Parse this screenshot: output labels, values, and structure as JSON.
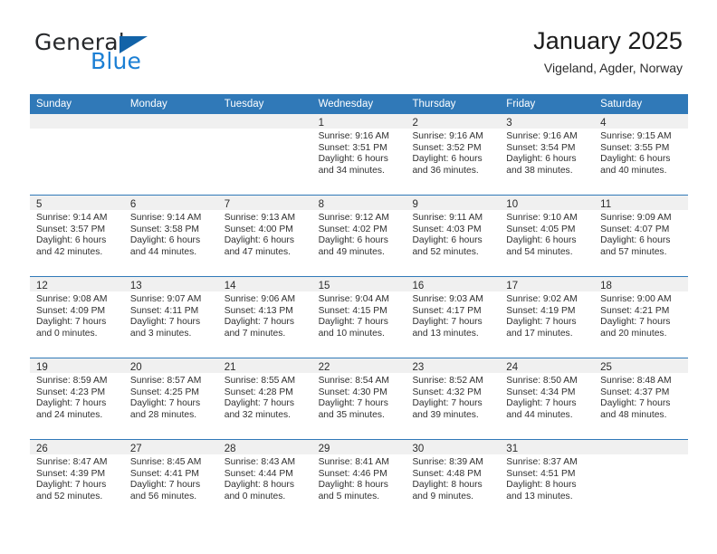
{
  "brand": {
    "word_one": "General",
    "word_two": "Blue",
    "flag_icon": "blue-triangle-flag-icon"
  },
  "header": {
    "title": "January 2025",
    "location": "Vigeland, Agder, Norway"
  },
  "colors": {
    "header_blue": "#3079b8",
    "brand_blue": "#1b7fd4",
    "flag_blue": "#1263a8",
    "daynum_band": "#f0f0f0"
  },
  "calendar": {
    "weekday_headers": [
      "Sunday",
      "Monday",
      "Tuesday",
      "Wednesday",
      "Thursday",
      "Friday",
      "Saturday"
    ],
    "weeks": [
      [
        {
          "day": "",
          "sunrise": "",
          "sunset": "",
          "daylight_1": "",
          "daylight_2": ""
        },
        {
          "day": "",
          "sunrise": "",
          "sunset": "",
          "daylight_1": "",
          "daylight_2": ""
        },
        {
          "day": "",
          "sunrise": "",
          "sunset": "",
          "daylight_1": "",
          "daylight_2": ""
        },
        {
          "day": "1",
          "sunrise": "Sunrise: 9:16 AM",
          "sunset": "Sunset: 3:51 PM",
          "daylight_1": "Daylight: 6 hours",
          "daylight_2": "and 34 minutes."
        },
        {
          "day": "2",
          "sunrise": "Sunrise: 9:16 AM",
          "sunset": "Sunset: 3:52 PM",
          "daylight_1": "Daylight: 6 hours",
          "daylight_2": "and 36 minutes."
        },
        {
          "day": "3",
          "sunrise": "Sunrise: 9:16 AM",
          "sunset": "Sunset: 3:54 PM",
          "daylight_1": "Daylight: 6 hours",
          "daylight_2": "and 38 minutes."
        },
        {
          "day": "4",
          "sunrise": "Sunrise: 9:15 AM",
          "sunset": "Sunset: 3:55 PM",
          "daylight_1": "Daylight: 6 hours",
          "daylight_2": "and 40 minutes."
        }
      ],
      [
        {
          "day": "5",
          "sunrise": "Sunrise: 9:14 AM",
          "sunset": "Sunset: 3:57 PM",
          "daylight_1": "Daylight: 6 hours",
          "daylight_2": "and 42 minutes."
        },
        {
          "day": "6",
          "sunrise": "Sunrise: 9:14 AM",
          "sunset": "Sunset: 3:58 PM",
          "daylight_1": "Daylight: 6 hours",
          "daylight_2": "and 44 minutes."
        },
        {
          "day": "7",
          "sunrise": "Sunrise: 9:13 AM",
          "sunset": "Sunset: 4:00 PM",
          "daylight_1": "Daylight: 6 hours",
          "daylight_2": "and 47 minutes."
        },
        {
          "day": "8",
          "sunrise": "Sunrise: 9:12 AM",
          "sunset": "Sunset: 4:02 PM",
          "daylight_1": "Daylight: 6 hours",
          "daylight_2": "and 49 minutes."
        },
        {
          "day": "9",
          "sunrise": "Sunrise: 9:11 AM",
          "sunset": "Sunset: 4:03 PM",
          "daylight_1": "Daylight: 6 hours",
          "daylight_2": "and 52 minutes."
        },
        {
          "day": "10",
          "sunrise": "Sunrise: 9:10 AM",
          "sunset": "Sunset: 4:05 PM",
          "daylight_1": "Daylight: 6 hours",
          "daylight_2": "and 54 minutes."
        },
        {
          "day": "11",
          "sunrise": "Sunrise: 9:09 AM",
          "sunset": "Sunset: 4:07 PM",
          "daylight_1": "Daylight: 6 hours",
          "daylight_2": "and 57 minutes."
        }
      ],
      [
        {
          "day": "12",
          "sunrise": "Sunrise: 9:08 AM",
          "sunset": "Sunset: 4:09 PM",
          "daylight_1": "Daylight: 7 hours",
          "daylight_2": "and 0 minutes."
        },
        {
          "day": "13",
          "sunrise": "Sunrise: 9:07 AM",
          "sunset": "Sunset: 4:11 PM",
          "daylight_1": "Daylight: 7 hours",
          "daylight_2": "and 3 minutes."
        },
        {
          "day": "14",
          "sunrise": "Sunrise: 9:06 AM",
          "sunset": "Sunset: 4:13 PM",
          "daylight_1": "Daylight: 7 hours",
          "daylight_2": "and 7 minutes."
        },
        {
          "day": "15",
          "sunrise": "Sunrise: 9:04 AM",
          "sunset": "Sunset: 4:15 PM",
          "daylight_1": "Daylight: 7 hours",
          "daylight_2": "and 10 minutes."
        },
        {
          "day": "16",
          "sunrise": "Sunrise: 9:03 AM",
          "sunset": "Sunset: 4:17 PM",
          "daylight_1": "Daylight: 7 hours",
          "daylight_2": "and 13 minutes."
        },
        {
          "day": "17",
          "sunrise": "Sunrise: 9:02 AM",
          "sunset": "Sunset: 4:19 PM",
          "daylight_1": "Daylight: 7 hours",
          "daylight_2": "and 17 minutes."
        },
        {
          "day": "18",
          "sunrise": "Sunrise: 9:00 AM",
          "sunset": "Sunset: 4:21 PM",
          "daylight_1": "Daylight: 7 hours",
          "daylight_2": "and 20 minutes."
        }
      ],
      [
        {
          "day": "19",
          "sunrise": "Sunrise: 8:59 AM",
          "sunset": "Sunset: 4:23 PM",
          "daylight_1": "Daylight: 7 hours",
          "daylight_2": "and 24 minutes."
        },
        {
          "day": "20",
          "sunrise": "Sunrise: 8:57 AM",
          "sunset": "Sunset: 4:25 PM",
          "daylight_1": "Daylight: 7 hours",
          "daylight_2": "and 28 minutes."
        },
        {
          "day": "21",
          "sunrise": "Sunrise: 8:55 AM",
          "sunset": "Sunset: 4:28 PM",
          "daylight_1": "Daylight: 7 hours",
          "daylight_2": "and 32 minutes."
        },
        {
          "day": "22",
          "sunrise": "Sunrise: 8:54 AM",
          "sunset": "Sunset: 4:30 PM",
          "daylight_1": "Daylight: 7 hours",
          "daylight_2": "and 35 minutes."
        },
        {
          "day": "23",
          "sunrise": "Sunrise: 8:52 AM",
          "sunset": "Sunset: 4:32 PM",
          "daylight_1": "Daylight: 7 hours",
          "daylight_2": "and 39 minutes."
        },
        {
          "day": "24",
          "sunrise": "Sunrise: 8:50 AM",
          "sunset": "Sunset: 4:34 PM",
          "daylight_1": "Daylight: 7 hours",
          "daylight_2": "and 44 minutes."
        },
        {
          "day": "25",
          "sunrise": "Sunrise: 8:48 AM",
          "sunset": "Sunset: 4:37 PM",
          "daylight_1": "Daylight: 7 hours",
          "daylight_2": "and 48 minutes."
        }
      ],
      [
        {
          "day": "26",
          "sunrise": "Sunrise: 8:47 AM",
          "sunset": "Sunset: 4:39 PM",
          "daylight_1": "Daylight: 7 hours",
          "daylight_2": "and 52 minutes."
        },
        {
          "day": "27",
          "sunrise": "Sunrise: 8:45 AM",
          "sunset": "Sunset: 4:41 PM",
          "daylight_1": "Daylight: 7 hours",
          "daylight_2": "and 56 minutes."
        },
        {
          "day": "28",
          "sunrise": "Sunrise: 8:43 AM",
          "sunset": "Sunset: 4:44 PM",
          "daylight_1": "Daylight: 8 hours",
          "daylight_2": "and 0 minutes."
        },
        {
          "day": "29",
          "sunrise": "Sunrise: 8:41 AM",
          "sunset": "Sunset: 4:46 PM",
          "daylight_1": "Daylight: 8 hours",
          "daylight_2": "and 5 minutes."
        },
        {
          "day": "30",
          "sunrise": "Sunrise: 8:39 AM",
          "sunset": "Sunset: 4:48 PM",
          "daylight_1": "Daylight: 8 hours",
          "daylight_2": "and 9 minutes."
        },
        {
          "day": "31",
          "sunrise": "Sunrise: 8:37 AM",
          "sunset": "Sunset: 4:51 PM",
          "daylight_1": "Daylight: 8 hours",
          "daylight_2": "and 13 minutes."
        },
        {
          "day": "",
          "sunrise": "",
          "sunset": "",
          "daylight_1": "",
          "daylight_2": ""
        }
      ]
    ]
  }
}
